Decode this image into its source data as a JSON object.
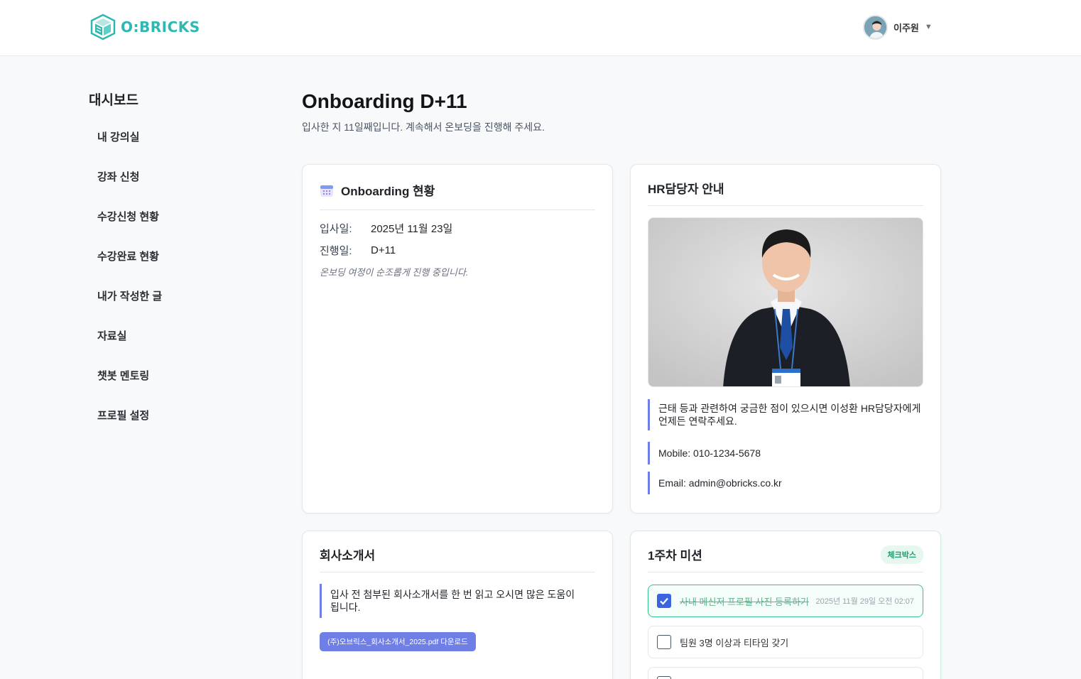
{
  "header": {
    "logo_text": "O:BRICKS",
    "user_name": "이주원"
  },
  "sidebar": {
    "title": "대시보드",
    "items": [
      {
        "label": "내 강의실"
      },
      {
        "label": "강좌 신청"
      },
      {
        "label": "수강신청 현황"
      },
      {
        "label": "수강완료 현황"
      },
      {
        "label": "내가 작성한 글"
      },
      {
        "label": "자료실"
      },
      {
        "label": "챗봇 멘토링"
      },
      {
        "label": "프로필 설정"
      }
    ]
  },
  "main": {
    "title": "Onboarding D+11",
    "subtitle": "입사한 지 11일째입니다. 계속해서 온보딩을 진행해 주세요."
  },
  "onboarding": {
    "title": "Onboarding 현황",
    "join_label": "입사일:",
    "join_value": "2025년 11월 23일",
    "progress_label": "진행일:",
    "progress_value": "D+11",
    "note": "온보딩 여정이 순조롭게 진행 중입니다."
  },
  "hr": {
    "title": "HR담당자 안내",
    "message": "근태 등과 관련하여 궁금한 점이 있으시면 이성환 HR담당자에게 언제든 연락주세요.",
    "mobile": "Mobile: 010-1234-5678",
    "email": "Email: admin@obricks.co.kr"
  },
  "company": {
    "title": "회사소개서",
    "message": "입사 전 첨부된 회사소개서를 한 번 읽고 오시면 많은 도움이 됩니다.",
    "download_label": "(주)오브릭스_회사소개서_2025.pdf 다운로드"
  },
  "missions": {
    "title": "1주차 미션",
    "badge": "체크박스",
    "items": [
      {
        "label": "사내 메신저 프로필 사진 등록하기",
        "done": true,
        "time": "2025년 11월 29일 오전 02:07"
      },
      {
        "label": "팀원 3명 이상과 티타임 갖기",
        "done": false,
        "time": ""
      }
    ]
  },
  "colors": {
    "brand": "#2fb7b0",
    "accent": "#6f7fe6",
    "success": "#34c28a",
    "check": "#3b64e0"
  }
}
